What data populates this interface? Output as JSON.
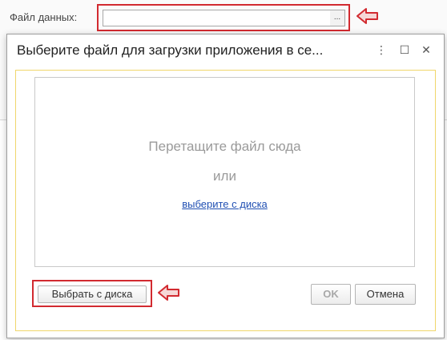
{
  "background_form": {
    "field_label": "Файл данных:",
    "browse_label": "..."
  },
  "dialog": {
    "title": "Выберите файл для загрузки приложения в се...",
    "dropzone": {
      "main_text": "Перетащите файл сюда",
      "or_text": "или",
      "link_text": "выберите с диска"
    },
    "buttons": {
      "choose_disk": "Выбрать с диска",
      "ok": "OK",
      "cancel": "Отмена"
    },
    "window_controls": {
      "menu": "⋮",
      "maximize": "☐",
      "close": "✕"
    }
  },
  "colors": {
    "highlight_frame": "#d22a30",
    "content_border": "#f0d66b",
    "link": "#2150b3"
  },
  "icons": [
    "arrow-left-icon",
    "more-vertical-icon",
    "maximize-icon",
    "close-icon"
  ]
}
